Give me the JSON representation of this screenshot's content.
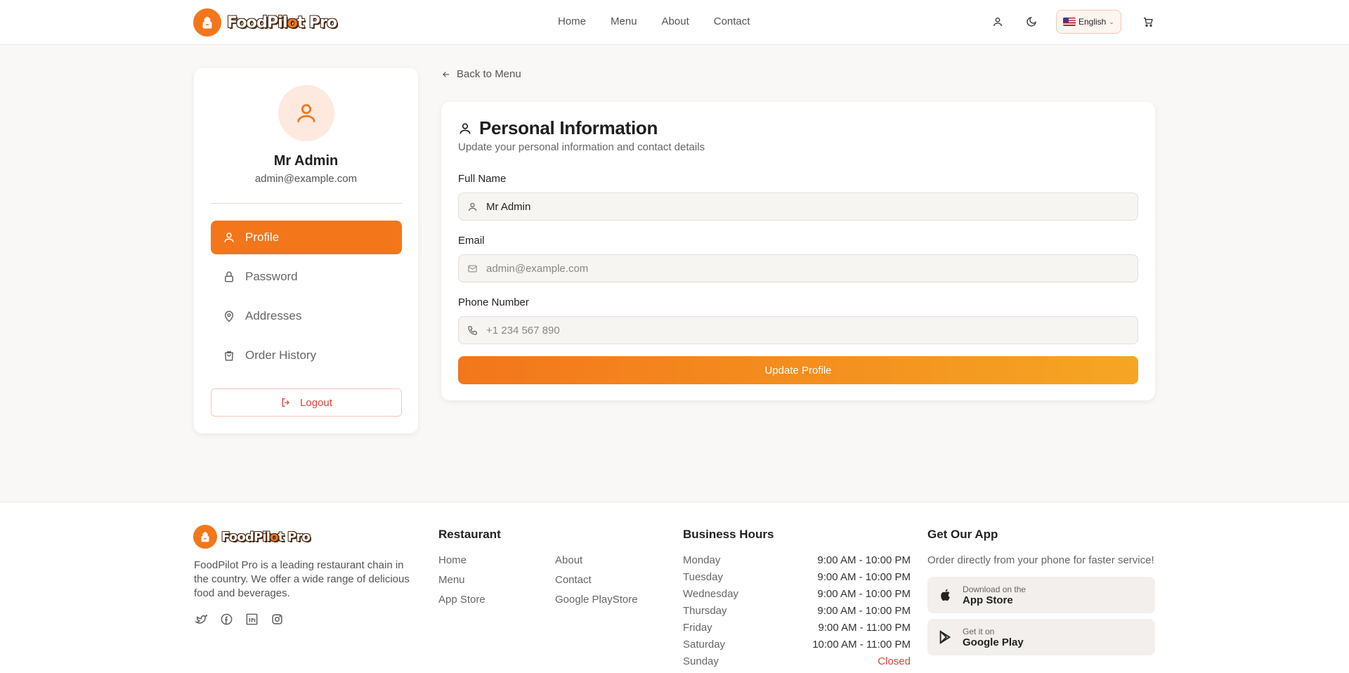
{
  "header": {
    "brand": {
      "part1": "Food",
      "part2": "Pil",
      "part3": "t",
      "part4": " Pro",
      "accent": "o"
    },
    "nav": [
      "Home",
      "Menu",
      "About",
      "Contact"
    ],
    "language": "English"
  },
  "sidebar": {
    "name": "Mr Admin",
    "email": "admin@example.com",
    "items": [
      {
        "label": "Profile",
        "icon": "user-icon",
        "active": true
      },
      {
        "label": "Password",
        "icon": "lock-icon",
        "active": false
      },
      {
        "label": "Addresses",
        "icon": "map-pin-icon",
        "active": false
      },
      {
        "label": "Order History",
        "icon": "shopping-bag-icon",
        "active": false
      }
    ],
    "logout": "Logout"
  },
  "main": {
    "back": "Back to Menu",
    "title": "Personal Information",
    "subtitle": "Update your personal information and contact details",
    "fields": {
      "full_name": {
        "label": "Full Name",
        "value": "Mr Admin"
      },
      "email": {
        "label": "Email",
        "placeholder": "admin@example.com"
      },
      "phone": {
        "label": "Phone Number",
        "placeholder": "+1 234 567 890"
      }
    },
    "submit": "Update Profile"
  },
  "footer": {
    "description": "FoodPilot Pro is a leading restaurant chain in the country. We offer a wide range of delicious food and beverages.",
    "restaurant": {
      "heading": "Restaurant",
      "links": [
        "Home",
        "About",
        "Menu",
        "Contact",
        "App Store",
        "Google PlayStore"
      ]
    },
    "hours": {
      "heading": "Business Hours",
      "rows": [
        {
          "day": "Monday",
          "time": "9:00 AM - 10:00 PM"
        },
        {
          "day": "Tuesday",
          "time": "9:00 AM - 10:00 PM"
        },
        {
          "day": "Wednesday",
          "time": "9:00 AM - 10:00 PM"
        },
        {
          "day": "Thursday",
          "time": "9:00 AM - 10:00 PM"
        },
        {
          "day": "Friday",
          "time": "9:00 AM - 11:00 PM"
        },
        {
          "day": "Saturday",
          "time": "10:00 AM - 11:00 PM"
        },
        {
          "day": "Sunday",
          "time": "Closed"
        }
      ]
    },
    "app": {
      "heading": "Get Our App",
      "description": "Order directly from your phone for faster service!",
      "appstore": {
        "small": "Download on the",
        "big": "App Store"
      },
      "googleplay": {
        "small": "Get it on",
        "big": "Google Play"
      }
    }
  },
  "colors": {
    "accent": "#f3761b",
    "accent2": "#f5a623",
    "danger": "#e0443b"
  }
}
